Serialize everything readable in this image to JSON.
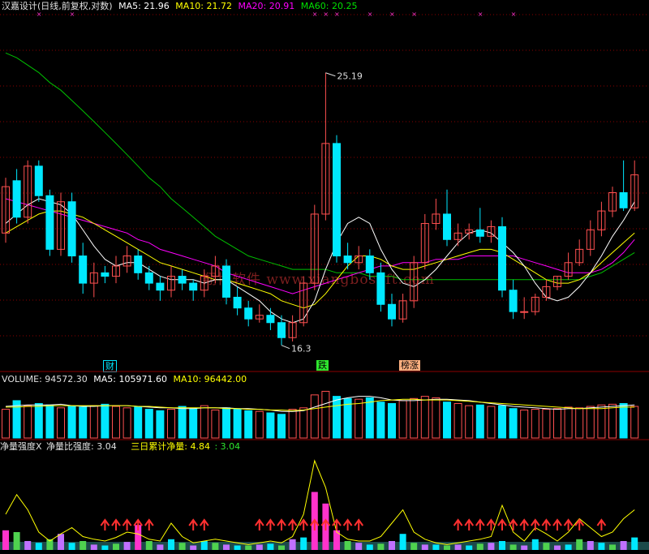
{
  "colors": {
    "up": "#ff5050",
    "down": "#00e8ff",
    "ma5": "#ffffff",
    "ma10": "#ffff00",
    "ma20": "#ff00ff",
    "ma60": "#00c000",
    "grid": "#8b0000",
    "pink": "#ff33cc",
    "yellow": "#ffff00",
    "green": "#2ee62e"
  },
  "header": {
    "title": "汉嘉设计(日线,前复权,对数)",
    "ma5": "MA5: 21.96",
    "ma10": "MA10: 21.72",
    "ma20": "MA20: 20.91",
    "ma60": "MA60: 20.25"
  },
  "volume_header": {
    "volume": "VOLUME: 94572.30",
    "ma5": "MA5: 105971.60",
    "ma10": "MA10: 96442.00"
  },
  "indicator_header": {
    "name": "净量强度X",
    "ratio": "净量比强度: 3.04",
    "cum_label": "三日累计净量: 4.84",
    "cum_extra": ": 3.04"
  },
  "watermark": "翔博软件  www.xiangbosoft.com",
  "annotations": {
    "high": "25.19",
    "low": "16.3",
    "tag_die": "跌",
    "tag_bang": "榜涨",
    "tag_cai": "财"
  },
  "chart_data": {
    "type": "candlestick",
    "count": 58,
    "opens": [
      19.5,
      21.2,
      20.0,
      21.7,
      20.7,
      19.0,
      20.5,
      18.8,
      18.0,
      18.3,
      18.2,
      18.5,
      18.8,
      18.3,
      18.0,
      17.8,
      18.2,
      18.0,
      17.8,
      18.2,
      18.5,
      17.6,
      17.3,
      17.0,
      17.1,
      16.9,
      16.5,
      16.9,
      18.0,
      20.1,
      22.5,
      18.8,
      18.6,
      18.8,
      18.3,
      17.4,
      17.0,
      17.5,
      18.6,
      19.8,
      20.1,
      19.3,
      19.5,
      19.6,
      19.4,
      19.7,
      17.8,
      17.2,
      17.2,
      17.6,
      17.9,
      18.2,
      18.6,
      19.0,
      19.6,
      20.2,
      20.8,
      20.3
    ],
    "closes": [
      21.0,
      20.0,
      21.7,
      20.7,
      19.0,
      20.5,
      18.8,
      18.0,
      18.3,
      18.2,
      18.5,
      18.8,
      18.3,
      18.0,
      17.8,
      18.2,
      18.0,
      17.8,
      18.2,
      18.5,
      17.6,
      17.3,
      17.0,
      17.1,
      16.9,
      16.5,
      16.9,
      18.0,
      20.1,
      22.5,
      18.8,
      18.6,
      18.8,
      18.3,
      17.4,
      17.0,
      17.5,
      18.6,
      19.8,
      20.1,
      19.3,
      19.5,
      19.6,
      19.4,
      19.7,
      17.8,
      17.2,
      17.2,
      17.6,
      17.9,
      18.2,
      18.6,
      19.0,
      19.6,
      20.2,
      20.8,
      20.3,
      21.4
    ],
    "highs": [
      21.3,
      21.6,
      21.9,
      21.9,
      20.9,
      20.8,
      20.8,
      19.2,
      18.6,
      18.5,
      18.8,
      19.1,
      19.0,
      18.5,
      18.2,
      18.5,
      18.4,
      18.1,
      18.4,
      18.8,
      18.7,
      17.9,
      17.5,
      17.4,
      17.3,
      17.1,
      17.1,
      18.2,
      20.4,
      25.19,
      22.8,
      19.2,
      19.1,
      19.0,
      18.6,
      17.7,
      17.7,
      18.8,
      20.1,
      20.6,
      20.9,
      19.8,
      19.8,
      20.3,
      19.9,
      20.0,
      18.1,
      17.6,
      17.7,
      18.1,
      18.2,
      18.9,
      19.3,
      19.9,
      20.5,
      21.0,
      21.9,
      21.9
    ],
    "lows": [
      19.2,
      19.8,
      19.8,
      20.5,
      18.8,
      18.8,
      18.6,
      17.7,
      17.6,
      18.0,
      18.0,
      18.3,
      18.1,
      17.8,
      17.5,
      17.6,
      17.8,
      17.5,
      17.6,
      18.0,
      17.4,
      17.1,
      16.8,
      16.9,
      16.7,
      16.3,
      16.4,
      16.8,
      17.8,
      19.9,
      18.6,
      18.4,
      18.4,
      18.1,
      17.2,
      16.8,
      16.9,
      17.3,
      18.4,
      19.6,
      19.1,
      19.1,
      19.3,
      19.2,
      19.2,
      17.6,
      17.0,
      17.0,
      17.1,
      17.5,
      17.8,
      18.1,
      18.5,
      18.8,
      19.4,
      20.0,
      20.2,
      20.2
    ],
    "ma5": [
      19.8,
      20.1,
      20.4,
      20.6,
      20.5,
      20.4,
      20.1,
      19.6,
      19.1,
      18.7,
      18.5,
      18.6,
      18.6,
      18.4,
      18.2,
      18.1,
      18.1,
      18.1,
      18.0,
      18.1,
      18.1,
      17.9,
      17.7,
      17.5,
      17.2,
      17.0,
      16.9,
      17.0,
      17.5,
      18.4,
      19.2,
      19.8,
      20.0,
      19.8,
      19.0,
      18.4,
      18.0,
      17.9,
      18.1,
      18.4,
      18.8,
      19.2,
      19.5,
      19.6,
      19.5,
      19.2,
      18.9,
      18.5,
      18.0,
      17.6,
      17.5,
      17.6,
      17.9,
      18.3,
      18.8,
      19.4,
      19.9,
      20.5
    ],
    "ma10": [
      19.5,
      19.7,
      19.9,
      20.1,
      20.2,
      20.2,
      20.1,
      20.0,
      19.8,
      19.6,
      19.4,
      19.2,
      19.0,
      18.8,
      18.6,
      18.5,
      18.4,
      18.3,
      18.2,
      18.1,
      18.1,
      18.0,
      17.9,
      17.8,
      17.7,
      17.5,
      17.4,
      17.3,
      17.4,
      17.7,
      18.1,
      18.5,
      18.8,
      18.8,
      18.7,
      18.5,
      18.4,
      18.4,
      18.5,
      18.6,
      18.7,
      18.8,
      18.9,
      19.0,
      19.0,
      18.9,
      18.7,
      18.5,
      18.3,
      18.1,
      18.0,
      18.0,
      18.1,
      18.3,
      18.6,
      18.9,
      19.2,
      19.5
    ],
    "ma20": [
      20.6,
      20.5,
      20.4,
      20.3,
      20.2,
      20.1,
      20.0,
      19.9,
      19.8,
      19.7,
      19.6,
      19.5,
      19.3,
      19.2,
      19.0,
      18.9,
      18.8,
      18.7,
      18.6,
      18.5,
      18.3,
      18.2,
      18.1,
      18.0,
      17.9,
      17.8,
      17.7,
      17.8,
      17.9,
      18.0,
      18.1,
      18.2,
      18.3,
      18.4,
      18.5,
      18.5,
      18.6,
      18.6,
      18.6,
      18.7,
      18.7,
      18.7,
      18.8,
      18.8,
      18.8,
      18.8,
      18.8,
      18.7,
      18.6,
      18.5,
      18.4,
      18.3,
      18.3,
      18.3,
      18.4,
      18.6,
      18.9,
      19.3
    ],
    "ma60": [
      26.0,
      25.8,
      25.5,
      25.2,
      24.8,
      24.5,
      24.1,
      23.7,
      23.3,
      22.9,
      22.5,
      22.1,
      21.7,
      21.3,
      21.0,
      20.6,
      20.3,
      20.0,
      19.7,
      19.4,
      19.2,
      19.0,
      18.8,
      18.7,
      18.6,
      18.5,
      18.4,
      18.4,
      18.4,
      18.4,
      18.3,
      18.3,
      18.3,
      18.2,
      18.2,
      18.2,
      18.1,
      18.1,
      18.1,
      18.1,
      18.1,
      18.1,
      18.1,
      18.1,
      18.1,
      18.1,
      18.1,
      18.1,
      18.1,
      18.1,
      18.1,
      18.1,
      18.1,
      18.2,
      18.3,
      18.5,
      18.7,
      18.9
    ],
    "volume": [
      40,
      52,
      45,
      48,
      46,
      42,
      44,
      43,
      45,
      47,
      44,
      42,
      43,
      40,
      38,
      40,
      44,
      41,
      45,
      39,
      42,
      40,
      38,
      37,
      35,
      33,
      40,
      42,
      60,
      65,
      58,
      55,
      54,
      56,
      50,
      48,
      52,
      55,
      58,
      56,
      50,
      48,
      45,
      46,
      44,
      45,
      41,
      39,
      40,
      40,
      41,
      43,
      42,
      44,
      46,
      47,
      48,
      44
    ],
    "vol_ma5": [
      44,
      45,
      46,
      46,
      46,
      47,
      45,
      44,
      44,
      45,
      45,
      45,
      44,
      43,
      42,
      42,
      41,
      41,
      42,
      42,
      42,
      41,
      41,
      40,
      39,
      37,
      37,
      38,
      43,
      48,
      53,
      56,
      58,
      58,
      56,
      53,
      52,
      52,
      53,
      54,
      54,
      53,
      52,
      50,
      48,
      46,
      44,
      43,
      42,
      41,
      40,
      41,
      41,
      42,
      43,
      44,
      45,
      46
    ],
    "vol_ma10": [
      43,
      43,
      44,
      44,
      45,
      45,
      45,
      45,
      45,
      45,
      45,
      45,
      44,
      44,
      43,
      42,
      42,
      42,
      42,
      42,
      41,
      41,
      40,
      40,
      39,
      39,
      38,
      39,
      41,
      43,
      45,
      47,
      48,
      50,
      52,
      53,
      54,
      54,
      53,
      53,
      53,
      52,
      51,
      50,
      49,
      48,
      47,
      46,
      45,
      44,
      43,
      42,
      41,
      41,
      41,
      42,
      43,
      43
    ],
    "strength": [
      0.22,
      0.2,
      0.1,
      0.08,
      0.12,
      0.18,
      0.08,
      0.1,
      0.06,
      0.05,
      0.07,
      0.09,
      0.28,
      0.1,
      0.06,
      0.12,
      0.08,
      0.05,
      0.1,
      0.08,
      0.06,
      0.05,
      0.05,
      0.06,
      0.07,
      0.05,
      0.12,
      0.14,
      0.65,
      0.52,
      0.22,
      0.1,
      0.08,
      0.06,
      0.07,
      0.1,
      0.18,
      0.08,
      0.06,
      0.06,
      0.05,
      0.06,
      0.05,
      0.07,
      0.08,
      0.1,
      0.06,
      0.05,
      0.12,
      0.08,
      0.05,
      0.06,
      0.12,
      0.1,
      0.08,
      0.06,
      0.1,
      0.14
    ],
    "strength_line": [
      0.4,
      0.62,
      0.45,
      0.2,
      0.1,
      0.18,
      0.25,
      0.15,
      0.12,
      0.1,
      0.14,
      0.2,
      0.18,
      0.12,
      0.1,
      0.3,
      0.15,
      0.08,
      0.1,
      0.12,
      0.1,
      0.08,
      0.06,
      0.08,
      0.1,
      0.08,
      0.15,
      0.4,
      1.0,
      0.7,
      0.2,
      0.12,
      0.1,
      0.1,
      0.15,
      0.3,
      0.45,
      0.2,
      0.12,
      0.08,
      0.06,
      0.08,
      0.1,
      0.12,
      0.15,
      0.5,
      0.2,
      0.1,
      0.25,
      0.18,
      0.1,
      0.2,
      0.35,
      0.25,
      0.15,
      0.2,
      0.35,
      0.45
    ],
    "arrow_groups": [
      [
        9,
        13
      ],
      [
        17,
        18
      ],
      [
        23,
        32
      ],
      [
        41,
        52
      ],
      [
        54,
        54
      ]
    ]
  }
}
